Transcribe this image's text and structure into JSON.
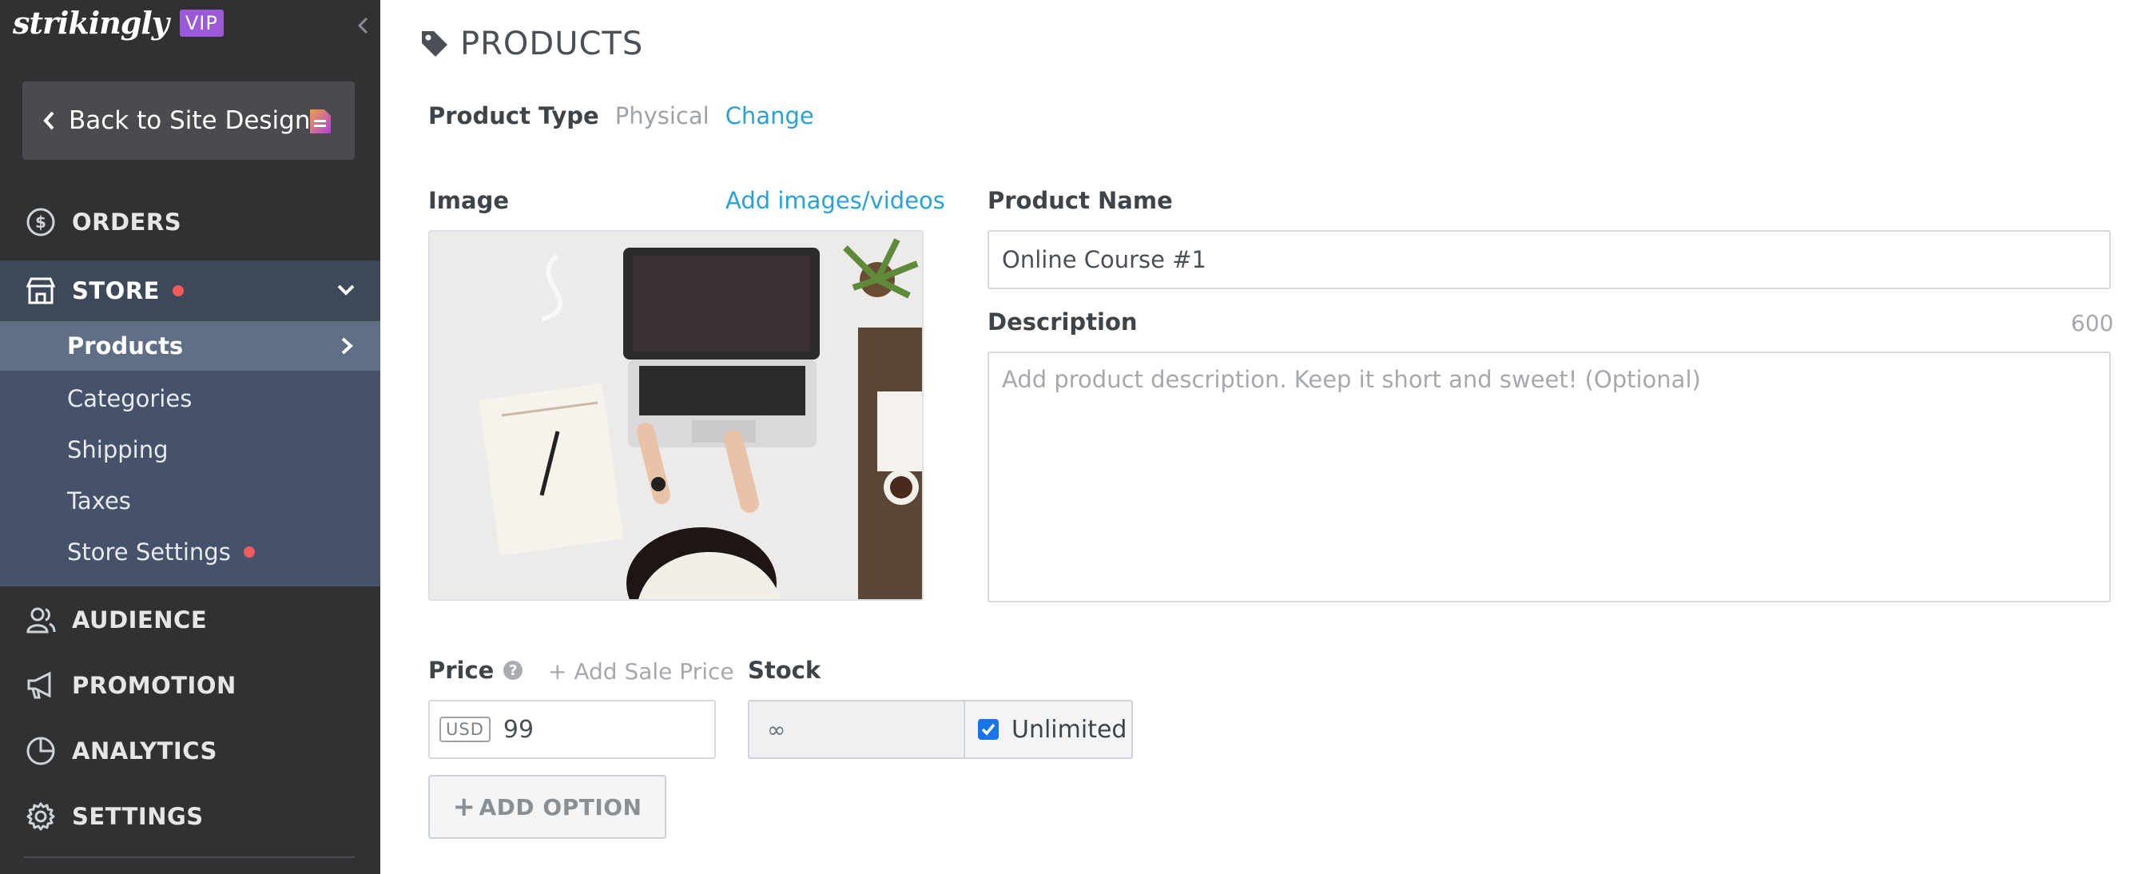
{
  "brand": {
    "logo": "strikingly",
    "badge": "VIP"
  },
  "sidebar": {
    "back_label": "Back to Site Design",
    "nav": {
      "orders": "ORDERS",
      "store": "STORE",
      "audience": "AUDIENCE",
      "promotion": "PROMOTION",
      "analytics": "ANALYTICS",
      "settings": "SETTINGS"
    },
    "store_items": [
      "Products",
      "Categories",
      "Shipping",
      "Taxes",
      "Store Settings"
    ]
  },
  "main": {
    "title": "PRODUCTS",
    "product_type": {
      "label": "Product Type",
      "value": "Physical",
      "change": "Change"
    },
    "image": {
      "label": "Image",
      "add_link": "Add images/videos"
    },
    "product_name": {
      "label": "Product Name",
      "value": "Online Course #1"
    },
    "description": {
      "label": "Description",
      "counter": "600",
      "placeholder": "Add product description. Keep it short and sweet! (Optional)"
    },
    "price": {
      "label": "Price",
      "help": "?",
      "sale_link": "+ Add Sale Price",
      "currency": "USD",
      "value": "99"
    },
    "stock": {
      "label": "Stock",
      "value": "∞",
      "unlimited_label": "Unlimited",
      "unlimited_checked": true
    },
    "add_option": {
      "plus": "+",
      "label": "ADD OPTION"
    }
  },
  "colors": {
    "sidebar_bg": "#303133",
    "store_bg": "#3d4858",
    "submenu_bg": "#45526a",
    "active_bg": "#5f6f86",
    "accent_link": "#2aa1d8",
    "badge": "#9b59d9",
    "notification_dot": "#f05a5a"
  }
}
